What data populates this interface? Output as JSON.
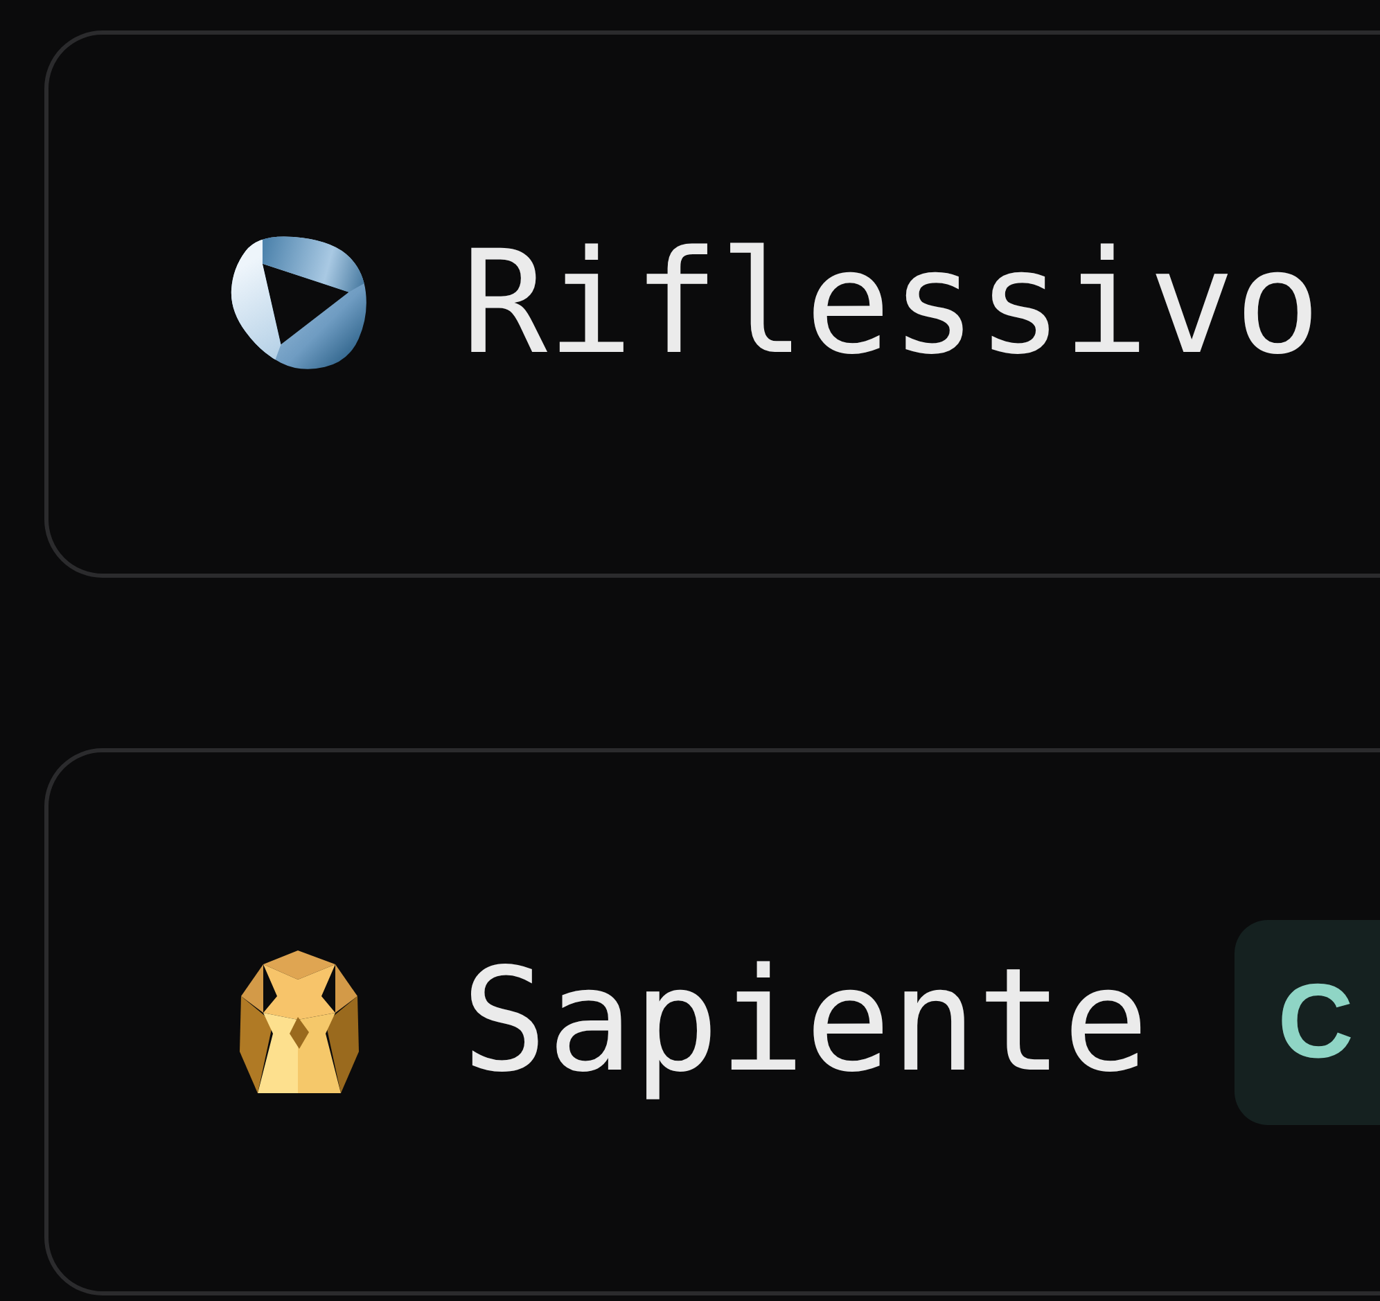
{
  "models": [
    {
      "name": "Riflessivo"
    },
    {
      "name": "Sapiente",
      "tag": "C"
    }
  ]
}
